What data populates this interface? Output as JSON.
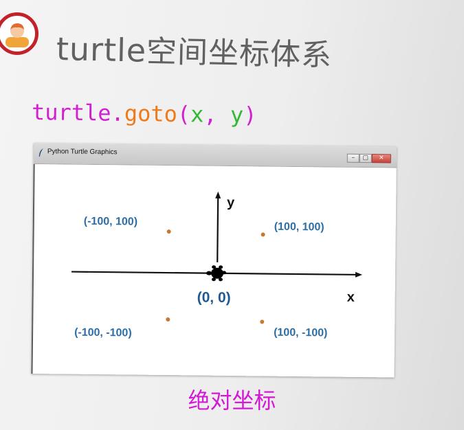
{
  "slide": {
    "title_latin": "turtle",
    "title_cjk": "空间坐标体系",
    "code": {
      "object": "turtle",
      "dot": ".",
      "method": "goto",
      "open_paren": "(",
      "arg1": "x",
      "comma": ", ",
      "arg2": "y",
      "close_paren": ")"
    },
    "caption": "绝对坐标",
    "icons": {
      "avatar": "user-avatar-icon"
    }
  },
  "window": {
    "title": "Python Turtle Graphics",
    "buttons": {
      "minimize": "–",
      "maximize": "▢",
      "close": "✕"
    },
    "icons": {
      "app": "feather-icon",
      "cursor": "turtle-icon"
    },
    "axes": {
      "x_label": "x",
      "y_label": "y"
    },
    "points": {
      "top_left": "(-100, 100)",
      "top_right": "(100, 100)",
      "origin": "(0, 0)",
      "bottom_left": "(-100, -100)",
      "bottom_right": "(100, -100)"
    }
  },
  "colors": {
    "code_magenta": "#d21fd2",
    "code_orange": "#f07a1a",
    "code_green": "#32b834",
    "label_blue": "#2d6ea6",
    "dot_orange": "#c9792f",
    "avatar_ring": "#c2232b",
    "caption_magenta": "#d419d4"
  }
}
